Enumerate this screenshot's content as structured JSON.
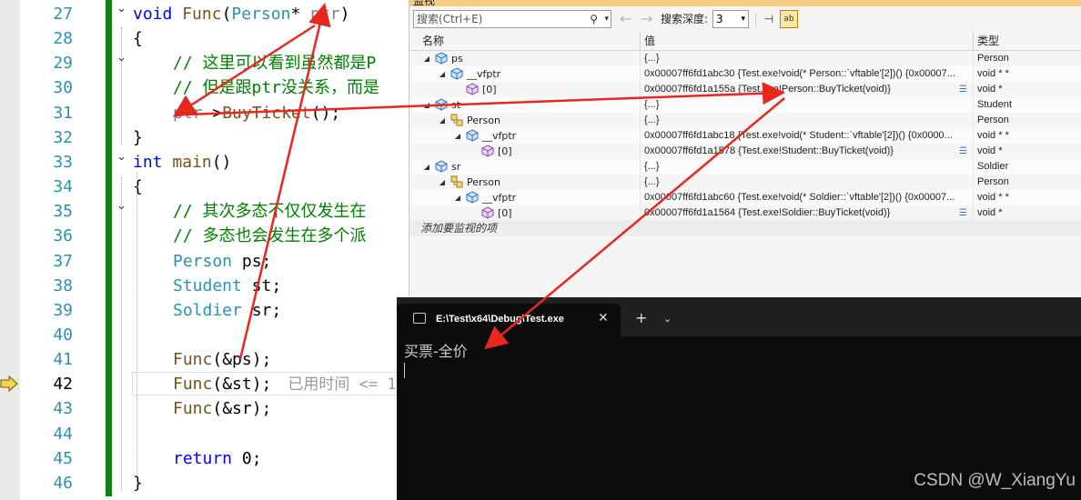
{
  "editor": {
    "line_numbers": [
      "27",
      "28",
      "29",
      "30",
      "31",
      "32",
      "33",
      "34",
      "35",
      "36",
      "37",
      "38",
      "39",
      "40",
      "41",
      "42",
      "43",
      "44",
      "45",
      "46"
    ],
    "current_line": "42",
    "lines": {
      "l27": {
        "kw": "void",
        "fn": "Func",
        "open": "(",
        "type": "Person",
        "rest": "* ",
        "param": "ptr",
        "close": ")"
      },
      "l28": "{",
      "l29": "// 这里可以看到虽然都是P",
      "l30": "// 但是跟ptr没关系，而是",
      "l31": {
        "obj": "ptr",
        "arrow": "->",
        "fn": "BuyTicket",
        "rest": "();"
      },
      "l32": "}",
      "l33": {
        "kw": "int",
        "fn": "main",
        "rest": "()"
      },
      "l34": "{",
      "l35": "// 其次多态不仅仅发生在",
      "l36": "// 多态也会发生在多个派",
      "l37": {
        "type": "Person",
        "rest": " ps;"
      },
      "l38": {
        "type": "Student",
        "rest": " st;"
      },
      "l39": {
        "type": "Soldier",
        "rest": " sr;"
      },
      "l41": {
        "fn": "Func",
        "rest": "(&ps);"
      },
      "l42": {
        "fn": "Func",
        "rest": "(&st);",
        "hint": "已用时间 <= 1"
      },
      "l43": {
        "fn": "Func",
        "rest": "(&sr);"
      },
      "l45": {
        "kw": "return",
        "rest": " 0;"
      },
      "l46": "}"
    }
  },
  "watch": {
    "title_partial": "监视",
    "search_placeholder": "搜索(Ctrl+E)",
    "depth_label": "搜索深度:",
    "depth_value": "3",
    "columns": {
      "name": "名称",
      "value": "值",
      "type": "类型"
    },
    "rows": [
      {
        "indent": 0,
        "expander": "◢",
        "name": "ps",
        "value": "{...}",
        "type": "Person",
        "icon": "object-icon"
      },
      {
        "indent": 1,
        "expander": "◢",
        "name": "__vfptr",
        "value": "0x00007ff6fd1abc30 {Test.exe!void(* Person::`vftable'[2])() {0x00007...",
        "type": "void * *",
        "icon": "object-icon"
      },
      {
        "indent": 2,
        "expander": "",
        "name": "[0]",
        "value": "0x00007ff6fd1a155a {Test.exe!Person::BuyTicket(void)}",
        "type": "void *",
        "icon": "field-icon",
        "visualizer": true
      },
      {
        "indent": 0,
        "expander": "◢",
        "name": "st",
        "value": "{...}",
        "type": "Student",
        "icon": "object-icon"
      },
      {
        "indent": 1,
        "expander": "◢",
        "name": "Person",
        "value": "{...}",
        "type": "Person",
        "icon": "base-class-icon"
      },
      {
        "indent": 2,
        "expander": "◢",
        "name": "__vfptr",
        "value": "0x00007ff6fd1abc18 {Test.exe!void(* Student::`vftable'[2])() {0x0000...",
        "type": "void * *",
        "icon": "object-icon"
      },
      {
        "indent": 3,
        "expander": "",
        "name": "[0]",
        "value": "0x00007ff6fd1a1578 {Test.exe!Student::BuyTicket(void)}",
        "type": "void *",
        "icon": "field-icon",
        "visualizer": true
      },
      {
        "indent": 0,
        "expander": "◢",
        "name": "sr",
        "value": "{...}",
        "type": "Soldier",
        "icon": "object-icon"
      },
      {
        "indent": 1,
        "expander": "◢",
        "name": "Person",
        "value": "{...}",
        "type": "Person",
        "icon": "base-class-icon"
      },
      {
        "indent": 2,
        "expander": "◢",
        "name": "__vfptr",
        "value": "0x00007ff6fd1abc60 {Test.exe!void(* Soldier::`vftable'[2])() {0x00007...",
        "type": "void * *",
        "icon": "object-icon"
      },
      {
        "indent": 3,
        "expander": "",
        "name": "[0]",
        "value": "0x00007ff6fd1a1564 {Test.exe!Soldier::BuyTicket(void)}",
        "type": "void *",
        "icon": "field-icon",
        "visualizer": true
      }
    ],
    "add_watch": "添加要监视的项"
  },
  "terminal": {
    "tab_title": "E:\\Test\\x64\\Debug\\Test.exe",
    "close_glyph": "✕",
    "add_glyph": "+",
    "dropdown_glyph": "⌄",
    "output": "买票-全价"
  },
  "watermark": "CSDN @W_XiangYu",
  "colors": {
    "annotation_arrow": "#e8281e",
    "change_bar": "#108010",
    "keyword": "#0000ff",
    "type": "#2b91af",
    "comment": "#008000"
  }
}
